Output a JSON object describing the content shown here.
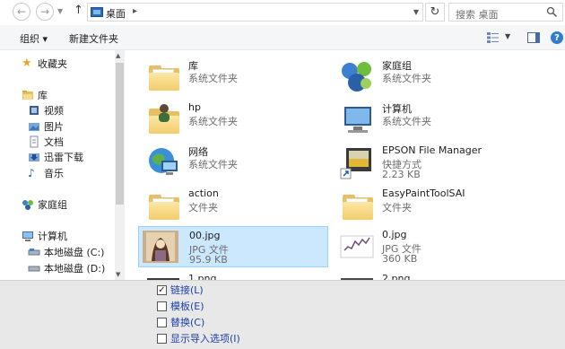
{
  "address": {
    "location": "桌面",
    "search_placeholder": "搜索 桌面"
  },
  "toolbar": {
    "organize": "组织 ▾",
    "new_folder": "新建文件夹"
  },
  "nav": {
    "favorites": "收藏夹",
    "library": "库",
    "videos": "视频",
    "pictures": "图片",
    "documents": "文档",
    "xunlei": "迅雷下载",
    "music": "音乐",
    "homegroup": "家庭组",
    "computer": "计算机",
    "disk_c": "本地磁盘 (C:)",
    "disk_d": "本地磁盘 (D:)"
  },
  "items": [
    {
      "name": "库",
      "type": "系统文件夹",
      "size": "",
      "icon": "library-folder-icon"
    },
    {
      "name": "家庭组",
      "type": "系统文件夹",
      "size": "",
      "icon": "homegroup-icon"
    },
    {
      "name": "hp",
      "type": "系统文件夹",
      "size": "",
      "icon": "user-folder-icon"
    },
    {
      "name": "计算机",
      "type": "系统文件夹",
      "size": "",
      "icon": "computer-icon"
    },
    {
      "name": "网络",
      "type": "系统文件夹",
      "size": "",
      "icon": "network-icon"
    },
    {
      "name": "EPSON File Manager",
      "type": "快捷方式",
      "size": "2.23 KB",
      "icon": "shortcut-icon"
    },
    {
      "name": "action",
      "type": "文件夹",
      "size": "",
      "icon": "folder-icon"
    },
    {
      "name": "EasyPaintToolSAI",
      "type": "文件夹",
      "size": "",
      "icon": "folder-icon"
    },
    {
      "name": "00.jpg",
      "type": "JPG 文件",
      "size": "95.9 KB",
      "icon": "image-thumbnail"
    },
    {
      "name": "0.jpg",
      "type": "JPG 文件",
      "size": "360 KB",
      "icon": "image-thumbnail"
    },
    {
      "name": "1.png",
      "type": "",
      "size": "",
      "icon": "image-thumbnail"
    },
    {
      "name": "2.png",
      "type": "",
      "size": "",
      "icon": "image-thumbnail"
    }
  ],
  "options": [
    {
      "label": "链接(L)",
      "checked": true
    },
    {
      "label": "模板(E)",
      "checked": false
    },
    {
      "label": "替换(C)",
      "checked": false
    },
    {
      "label": "显示导入选项(I)",
      "checked": false
    }
  ],
  "colors": {
    "selection": "#cce8ff",
    "link": "#1a3fa8",
    "folder": "#e8c062"
  }
}
